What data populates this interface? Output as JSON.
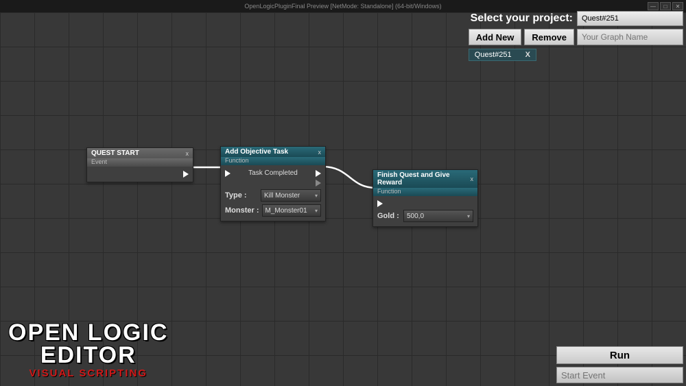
{
  "titlebar": "OpenLogicPluginFinal Preview [NetMode: Standalone]  (64-bit/Windows)",
  "panel": {
    "select_label": "Select your project:",
    "project_value": "Quest#251",
    "add_new": "Add New",
    "remove": "Remove",
    "graph_placeholder": "Your Graph Name",
    "tag_label": "Quest#251",
    "tag_close": "X"
  },
  "nodes": {
    "quest_start": {
      "title": "QUEST START",
      "subtitle": "Event"
    },
    "add_task": {
      "title": "Add Objective Task",
      "subtitle": "Function",
      "out_label": "Task Completed",
      "type_label": "Type :",
      "type_value": "Kill Monster",
      "monster_label": "Monster :",
      "monster_value": "M_Monster01"
    },
    "finish": {
      "title": "Finish Quest and Give Reward",
      "subtitle": "Function",
      "gold_label": "Gold :",
      "gold_value": "500,0"
    }
  },
  "run": {
    "button": "Run",
    "placeholder": "Start Event"
  },
  "logo": {
    "line1": "OPEN LOGIC",
    "line2": "EDITOR",
    "sub": "VISUAL SCRIPTING"
  }
}
